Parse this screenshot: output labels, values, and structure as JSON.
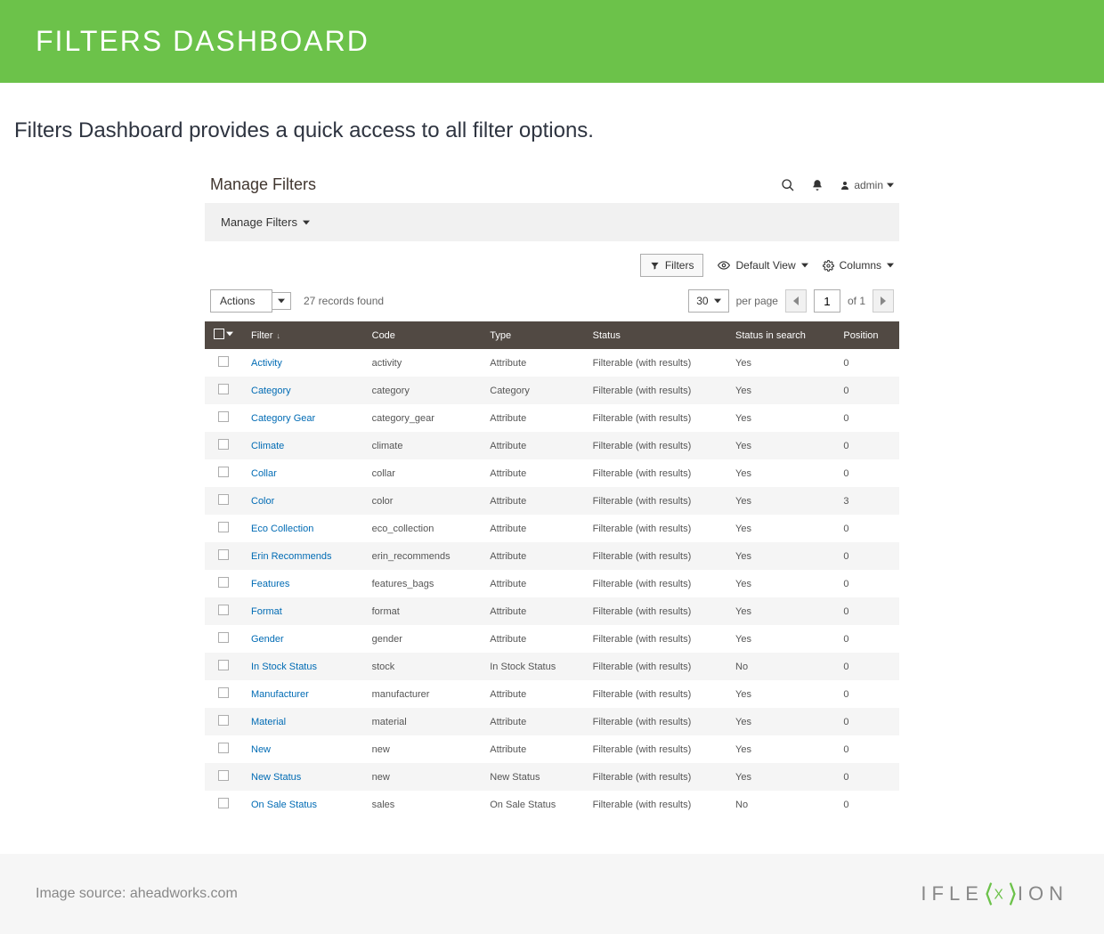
{
  "banner": {
    "title": "FILTERS DASHBOARD"
  },
  "intro": {
    "text": "Filters Dashboard provides a quick access to all filter options."
  },
  "panel": {
    "title": "Manage Filters",
    "user": "admin",
    "subbar": "Manage Filters",
    "toolbar": {
      "filters": "Filters",
      "default_view": "Default View",
      "columns": "Columns"
    },
    "actions_label": "Actions",
    "records_found": "27 records found",
    "per_page_value": "30",
    "per_page_label": "per page",
    "page_current": "1",
    "page_total": "of 1",
    "columns": [
      "Filter",
      "Code",
      "Type",
      "Status",
      "Status in search",
      "Position"
    ],
    "rows": [
      {
        "filter": "Activity",
        "code": "activity",
        "type": "Attribute",
        "status": "Filterable (with results)",
        "status_search": "Yes",
        "position": "0"
      },
      {
        "filter": "Category",
        "code": "category",
        "type": "Category",
        "status": "Filterable (with results)",
        "status_search": "Yes",
        "position": "0"
      },
      {
        "filter": "Category Gear",
        "code": "category_gear",
        "type": "Attribute",
        "status": "Filterable (with results)",
        "status_search": "Yes",
        "position": "0"
      },
      {
        "filter": "Climate",
        "code": "climate",
        "type": "Attribute",
        "status": "Filterable (with results)",
        "status_search": "Yes",
        "position": "0"
      },
      {
        "filter": "Collar",
        "code": "collar",
        "type": "Attribute",
        "status": "Filterable (with results)",
        "status_search": "Yes",
        "position": "0"
      },
      {
        "filter": "Color",
        "code": "color",
        "type": "Attribute",
        "status": "Filterable (with results)",
        "status_search": "Yes",
        "position": "3"
      },
      {
        "filter": "Eco Collection",
        "code": "eco_collection",
        "type": "Attribute",
        "status": "Filterable (with results)",
        "status_search": "Yes",
        "position": "0"
      },
      {
        "filter": "Erin Recommends",
        "code": "erin_recommends",
        "type": "Attribute",
        "status": "Filterable (with results)",
        "status_search": "Yes",
        "position": "0"
      },
      {
        "filter": "Features",
        "code": "features_bags",
        "type": "Attribute",
        "status": "Filterable (with results)",
        "status_search": "Yes",
        "position": "0"
      },
      {
        "filter": "Format",
        "code": "format",
        "type": "Attribute",
        "status": "Filterable (with results)",
        "status_search": "Yes",
        "position": "0"
      },
      {
        "filter": "Gender",
        "code": "gender",
        "type": "Attribute",
        "status": "Filterable (with results)",
        "status_search": "Yes",
        "position": "0"
      },
      {
        "filter": "In Stock Status",
        "code": "stock",
        "type": "In Stock Status",
        "status": "Filterable (with results)",
        "status_search": "No",
        "position": "0"
      },
      {
        "filter": "Manufacturer",
        "code": "manufacturer",
        "type": "Attribute",
        "status": "Filterable (with results)",
        "status_search": "Yes",
        "position": "0"
      },
      {
        "filter": "Material",
        "code": "material",
        "type": "Attribute",
        "status": "Filterable (with results)",
        "status_search": "Yes",
        "position": "0"
      },
      {
        "filter": "New",
        "code": "new",
        "type": "Attribute",
        "status": "Filterable (with results)",
        "status_search": "Yes",
        "position": "0"
      },
      {
        "filter": "New Status",
        "code": "new",
        "type": "New Status",
        "status": "Filterable (with results)",
        "status_search": "Yes",
        "position": "0"
      },
      {
        "filter": "On Sale Status",
        "code": "sales",
        "type": "On Sale Status",
        "status": "Filterable (with results)",
        "status_search": "No",
        "position": "0"
      }
    ]
  },
  "footer": {
    "source": "Image source: aheadworks.com",
    "logo_left": "IFLE",
    "logo_mid": "X",
    "logo_right": "ION"
  }
}
